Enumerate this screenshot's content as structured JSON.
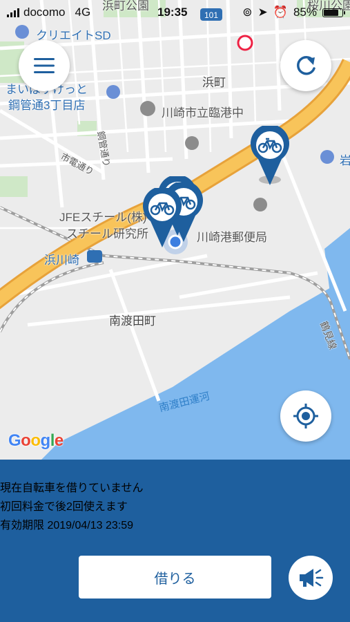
{
  "status_bar": {
    "carrier": "docomo",
    "network": "4G",
    "time": "19:35",
    "battery": "85%",
    "battery_level": 0.85
  },
  "map": {
    "labels": {
      "park_top": "浜町公園",
      "park_top_right": "桜川公園",
      "creative_sd": "クリエイトSD",
      "shop_a": "まいばすけっと",
      "shop_b": "鋼管通3丁目店",
      "hamacho": "浜町",
      "school": "川崎市立臨港中",
      "kokan_dori": "鋼管通り",
      "shiden_dori": "市電通り",
      "jfe_1": "JFEスチール(株)",
      "jfe_2": "スチール研究所",
      "post_office": "川崎港郵便局",
      "hamakawasaki": "浜川崎",
      "minamiwatarida": "南渡田町",
      "canal": "南渡田運河",
      "tsurumi_line": "鶴見線",
      "route_shield": "101",
      "iwa": "岩"
    },
    "google": [
      "G",
      "o",
      "o",
      "g",
      "l",
      "e"
    ],
    "colors": {
      "land": "#ececec",
      "road": "#ffffff",
      "highway": "#f5b23f",
      "water": "#7fb8ee",
      "park": "#cfe8c7",
      "pin": "#1e5f9e",
      "user": "#3d7fe0"
    }
  },
  "panel": {
    "line1": "現在自転車を借りていません",
    "line2": "初回料金で後2回使えます",
    "line3": "有効期限 2019/04/13 23:59",
    "rent_label": "借りる",
    "background": "#1e5f9e"
  }
}
